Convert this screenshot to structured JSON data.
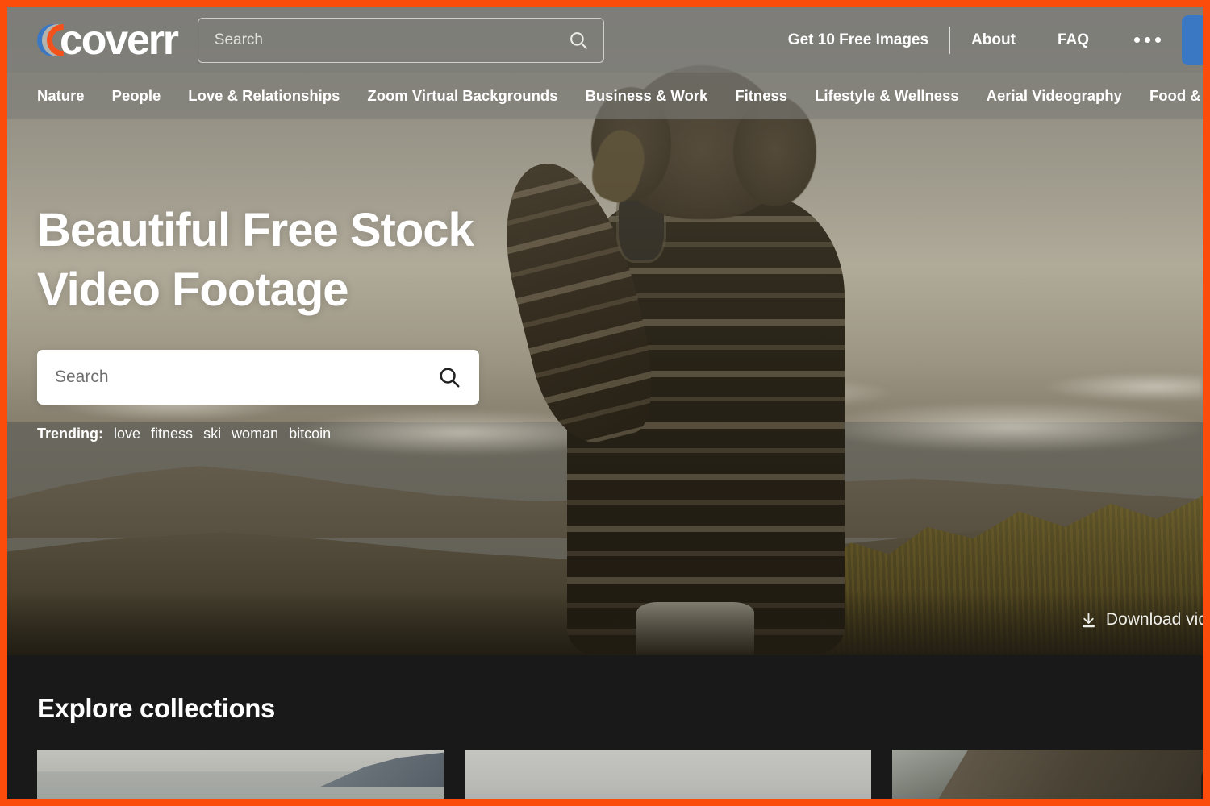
{
  "brand": {
    "name": "coverr",
    "accent_orange": "#fb4c0c",
    "accent_blue": "#3b78c4",
    "logo_arc_colors": [
      "#3b78c4",
      "#b3b3ae",
      "#f4521d"
    ]
  },
  "header": {
    "search_placeholder": "Search",
    "search_value": "",
    "nav": [
      {
        "label": "Get 10 Free Images"
      },
      {
        "label": "About"
      },
      {
        "label": "FAQ"
      }
    ],
    "more_menu": "•••"
  },
  "category_nav": [
    {
      "label": "Nature"
    },
    {
      "label": "People"
    },
    {
      "label": "Love & Relationships"
    },
    {
      "label": "Zoom Virtual Backgrounds"
    },
    {
      "label": "Business & Work"
    },
    {
      "label": "Fitness"
    },
    {
      "label": "Lifestyle & Wellness"
    },
    {
      "label": "Aerial Videography"
    },
    {
      "label": "Food & Drink"
    }
  ],
  "hero": {
    "title_line1": "Beautiful Free Stock",
    "title_line2": "Video Footage",
    "search_placeholder": "Search",
    "search_value": "",
    "trending_label": "Trending:",
    "trending_tags": [
      "love",
      "fitness",
      "ski",
      "woman",
      "bitcoin"
    ],
    "download_label": "Download vid"
  },
  "explore": {
    "title": "Explore collections",
    "cards": [
      {
        "alt": "coastal-seascape-collection"
      },
      {
        "alt": "light-gray-collection"
      },
      {
        "alt": "car-interior-road-collection"
      }
    ]
  }
}
